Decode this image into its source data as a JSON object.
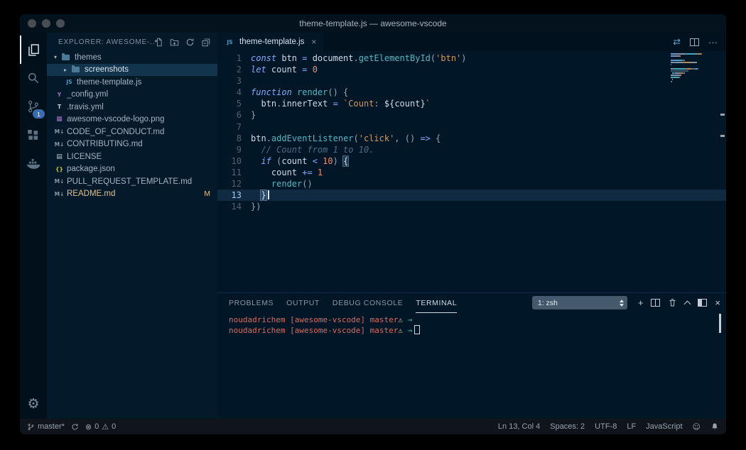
{
  "window": {
    "title": "theme-template.js — awesome-vscode"
  },
  "activity_bar": {
    "scm_badge": "1",
    "settings_glyph": "⚙"
  },
  "icon_glyphs": {
    "js": "JS",
    "md": "M↓",
    "json": "{}",
    "yml": "Y",
    "travis": "T",
    "image": "▦",
    "license": "▤"
  },
  "sidebar": {
    "header": {
      "title": "EXPLORER: AWESOME-..."
    },
    "tree": [
      {
        "label": "themes",
        "kind": "folder",
        "depth": 0,
        "arrow": "▾"
      },
      {
        "label": "screenshots",
        "kind": "folder",
        "depth": 1,
        "arrow": "▸",
        "selected": true
      },
      {
        "label": "theme-template.js",
        "kind": "js",
        "depth": 1
      },
      {
        "label": "_config.yml",
        "kind": "yml",
        "depth": 0
      },
      {
        "label": ".travis.yml",
        "kind": "travis",
        "depth": 0
      },
      {
        "label": "awesome-vscode-logo.png",
        "kind": "image",
        "depth": 0
      },
      {
        "label": "CODE_OF_CONDUCT.md",
        "kind": "md",
        "depth": 0
      },
      {
        "label": "CONTRIBUTING.md",
        "kind": "md",
        "depth": 0
      },
      {
        "label": "LICENSE",
        "kind": "license",
        "depth": 0
      },
      {
        "label": "package.json",
        "kind": "json",
        "depth": 0
      },
      {
        "label": "PULL_REQUEST_TEMPLATE.md",
        "kind": "md",
        "depth": 0
      },
      {
        "label": "README.md",
        "kind": "md",
        "depth": 0,
        "badge": "M",
        "modified": true
      }
    ]
  },
  "editor": {
    "tab": {
      "label": "theme-template.js",
      "close_glyph": "×"
    },
    "action_icons": {
      "open_changes": "⇄",
      "more": "···"
    },
    "code": [
      {
        "n": 1,
        "tokens": [
          [
            "kw",
            "const"
          ],
          [
            "d",
            " btn "
          ],
          [
            "op",
            "="
          ],
          [
            "d",
            " document"
          ],
          [
            "p",
            "."
          ],
          [
            "fn",
            "getElementById"
          ],
          [
            "p",
            "("
          ],
          [
            "s",
            "'btn'"
          ],
          [
            "p",
            ")"
          ]
        ]
      },
      {
        "n": 2,
        "tokens": [
          [
            "kw",
            "let"
          ],
          [
            "d",
            " count "
          ],
          [
            "op",
            "="
          ],
          [
            "n",
            " 0"
          ]
        ]
      },
      {
        "n": 3,
        "tokens": []
      },
      {
        "n": 4,
        "tokens": [
          [
            "kw",
            "function"
          ],
          [
            "fn",
            " render"
          ],
          [
            "p",
            "() {"
          ]
        ]
      },
      {
        "n": 5,
        "tokens": [
          [
            "d",
            "  btn"
          ],
          [
            "p",
            "."
          ],
          [
            "d",
            "innerText "
          ],
          [
            "op",
            "="
          ],
          [
            "s",
            " `Count: "
          ],
          [
            "ip",
            "${"
          ],
          [
            "d",
            "count"
          ],
          [
            "ip",
            "}"
          ],
          [
            "s",
            "`"
          ]
        ]
      },
      {
        "n": 6,
        "tokens": [
          [
            "p",
            "}"
          ]
        ]
      },
      {
        "n": 7,
        "tokens": []
      },
      {
        "n": 8,
        "tokens": [
          [
            "d",
            "btn"
          ],
          [
            "p",
            "."
          ],
          [
            "fn",
            "addEventListener"
          ],
          [
            "p",
            "("
          ],
          [
            "s",
            "'click'"
          ],
          [
            "p",
            ", () "
          ],
          [
            "op",
            "=>"
          ],
          [
            "p",
            " {"
          ]
        ]
      },
      {
        "n": 9,
        "tokens": [
          [
            "c",
            "  // Count from 1 to 10."
          ]
        ]
      },
      {
        "n": 10,
        "tokens": [
          [
            "p",
            "  "
          ],
          [
            "kw",
            "if"
          ],
          [
            "p",
            " ("
          ],
          [
            "d",
            "count "
          ],
          [
            "op",
            "<"
          ],
          [
            "n",
            " 10"
          ],
          [
            "p",
            ") "
          ],
          [
            "bm",
            "{"
          ]
        ]
      },
      {
        "n": 11,
        "tokens": [
          [
            "d",
            "    count "
          ],
          [
            "op",
            "+="
          ],
          [
            "n",
            " 1"
          ]
        ]
      },
      {
        "n": 12,
        "tokens": [
          [
            "fn",
            "    render"
          ],
          [
            "p",
            "()"
          ]
        ]
      },
      {
        "n": 13,
        "tokens": [
          [
            "p",
            "  "
          ],
          [
            "bm",
            "}"
          ]
        ],
        "current": true,
        "cursor": true
      },
      {
        "n": 14,
        "tokens": [
          [
            "p",
            "})"
          ]
        ]
      }
    ]
  },
  "panel": {
    "tabs": [
      {
        "label": "PROBLEMS"
      },
      {
        "label": "OUTPUT"
      },
      {
        "label": "DEBUG CONSOLE"
      },
      {
        "label": "TERMINAL",
        "active": true
      }
    ],
    "shell_select": "1: zsh",
    "action_icons": {
      "add": "+",
      "close": "×"
    },
    "terminal": [
      {
        "tokens": [
          [
            "tr",
            "noudadrichem [awesome-vscode] master"
          ],
          [
            "ty",
            "⚠"
          ],
          [
            "tc",
            " →"
          ]
        ]
      },
      {
        "tokens": [
          [
            "tr",
            "noudadrichem [awesome-vscode] master"
          ],
          [
            "ty",
            "⚠"
          ],
          [
            "tc",
            " →"
          ]
        ],
        "cursor": true
      }
    ]
  },
  "status_bar": {
    "branch": "master*",
    "errors": "0",
    "warnings": "0",
    "ln_col": "Ln 13, Col 4",
    "spaces": "Spaces: 2",
    "encoding": "UTF-8",
    "eol": "LF",
    "language": "JavaScript",
    "icons": {
      "error": "⊗",
      "warning": "⚠",
      "smiley": "☺"
    }
  }
}
